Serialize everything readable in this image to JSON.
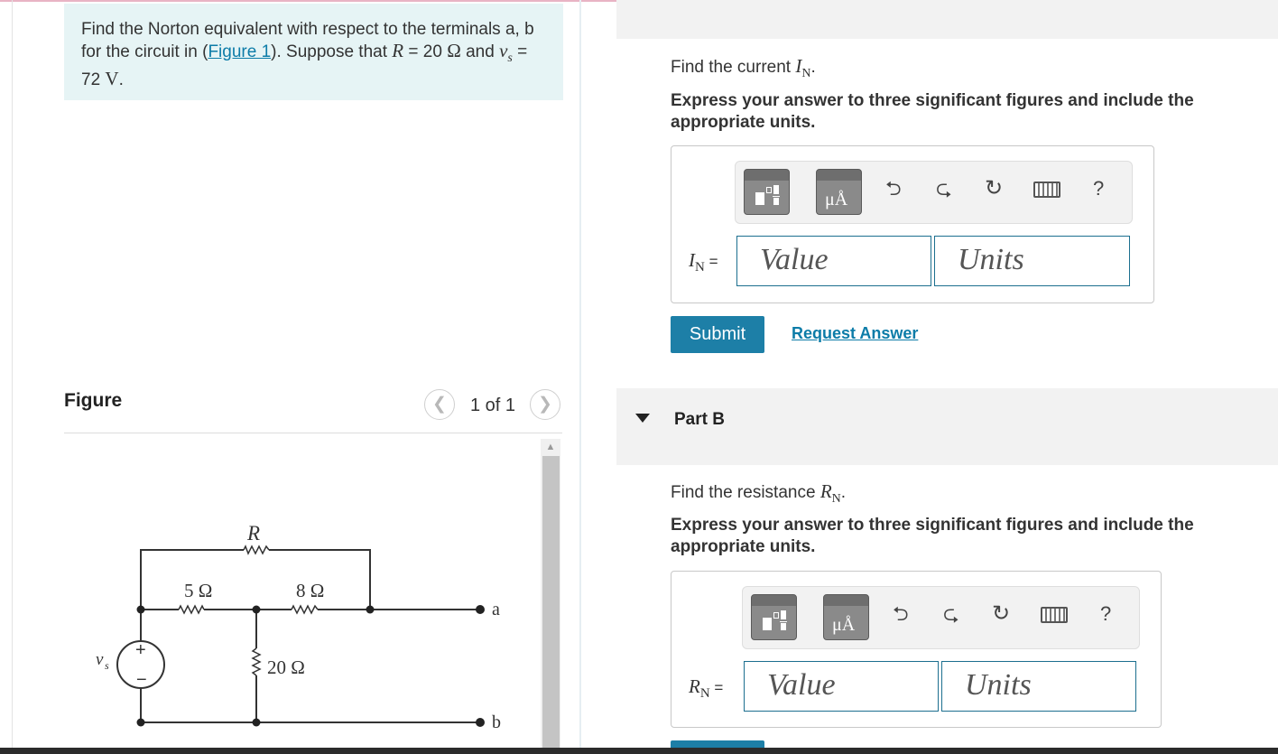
{
  "problem": {
    "text_before_link": "Find the Norton equivalent with respect to the terminals a, b for the circuit in (",
    "link": "Figure 1",
    "text_after_link": "). Suppose that ",
    "r_var": "R",
    "r_eq": " = 20 ",
    "r_unit": "Ω",
    "and": " and ",
    "vs_var": "v",
    "vs_sub": "s",
    "vs_eq": " = 72 ",
    "vs_unit": "V",
    "period": "."
  },
  "figure": {
    "title": "Figure",
    "counter": "1 of 1",
    "prev_icon": "chevron-left",
    "next_icon": "chevron-right",
    "circuit": {
      "R_label": "R",
      "r5_label": "5 Ω",
      "r8_label": "8 Ω",
      "r20_label": "20 Ω",
      "source_label_var": "v",
      "source_label_sub": "s",
      "plus": "+",
      "minus": "−",
      "terminal_a": "a",
      "terminal_b": "b"
    }
  },
  "partA": {
    "instruction_prefix": "Find the current ",
    "var": "I",
    "sub": "N",
    "period": ".",
    "emphasis": "Express your answer to three significant figures and include the appropriate units.",
    "equation_label_var": "I",
    "equation_label_sub": "N",
    "equation_eq": " =",
    "value_placeholder": "Value",
    "units_placeholder": "Units",
    "submit": "Submit",
    "request_answer": "Request Answer"
  },
  "partB": {
    "title": "Part B",
    "instruction_prefix": "Find the resistance ",
    "var": "R",
    "sub": "N",
    "period": ".",
    "emphasis": "Express your answer to three significant figures and include the appropriate units.",
    "equation_label_var": "R",
    "equation_label_sub": "N",
    "equation_eq": " =",
    "value_placeholder": "Value",
    "units_placeholder": "Units"
  },
  "toolbar": {
    "symbols_label": "μÅ",
    "help": "?",
    "icons": [
      "templates-icon",
      "symbols-icon",
      "undo-icon",
      "redo-icon",
      "reset-icon",
      "keyboard-icon",
      "help-icon"
    ]
  },
  "colors": {
    "accent": "#1d7fa7",
    "link": "#0c7ca8",
    "problem_bg": "#e6f4f5",
    "field_border": "#1c6f8f"
  }
}
